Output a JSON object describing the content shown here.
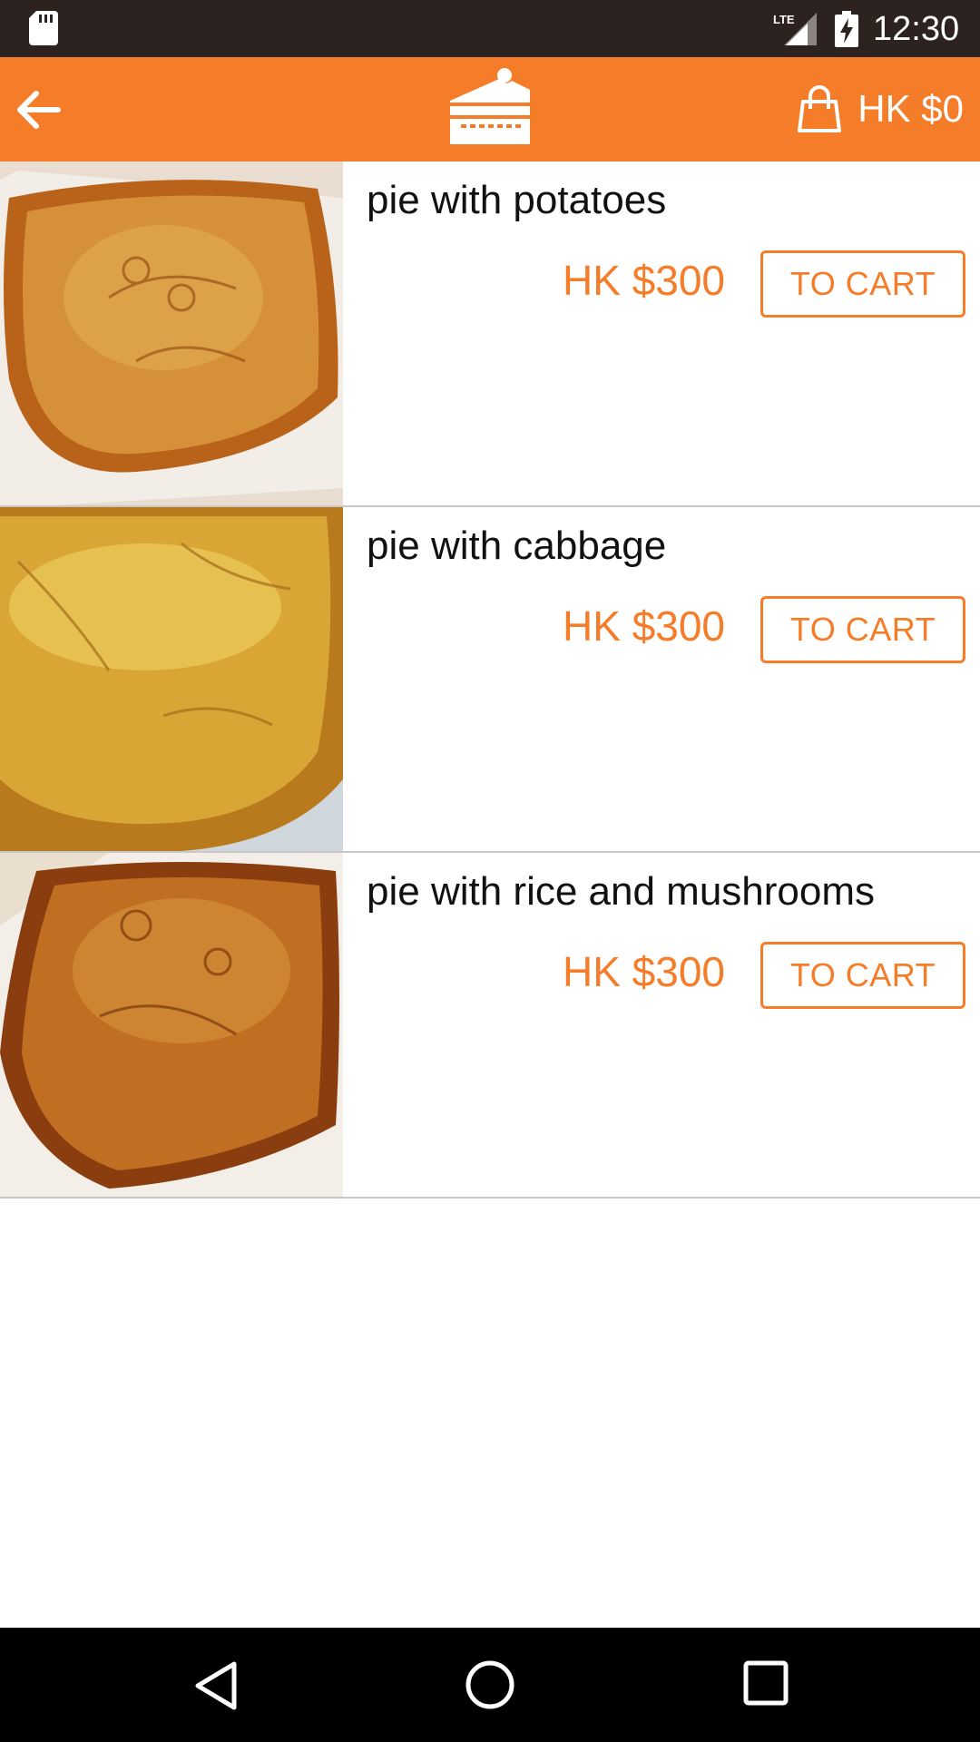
{
  "status_bar": {
    "time": "12:30",
    "network_label": "LTE",
    "icons": [
      "sd-card-icon",
      "lte-signal-icon",
      "battery-charging-icon"
    ]
  },
  "toolbar": {
    "back_icon": "arrow-left-icon",
    "logo_icon": "cake-slice-icon",
    "cart_icon": "shopping-bag-icon",
    "cart_total": "HK $0"
  },
  "products": [
    {
      "name": "pie with potatoes",
      "price": "HK $300",
      "button_label": "TO CART",
      "image": "pie-photo"
    },
    {
      "name": "pie with cabbage",
      "price": "HK $300",
      "button_label": "TO CART",
      "image": "pie-photo"
    },
    {
      "name": "pie with rice and mushrooms",
      "price": "HK $300",
      "button_label": "TO CART",
      "image": "pie-photo"
    }
  ],
  "nav_bar": {
    "icons": [
      "nav-back-icon",
      "nav-home-icon",
      "nav-recent-icon"
    ]
  },
  "colors": {
    "accent": "#f57c28",
    "status_bar": "#2c2220",
    "nav_bar": "#000000",
    "divider": "#c8c8c8"
  }
}
